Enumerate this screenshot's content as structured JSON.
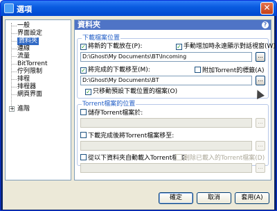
{
  "window": {
    "title": "選項",
    "close_label": "✕"
  },
  "tree": {
    "items": [
      {
        "label": "一般"
      },
      {
        "label": "界面設定"
      },
      {
        "label": "資料夾"
      },
      {
        "label": "連線"
      },
      {
        "label": "流量"
      },
      {
        "label": "BitTorrent"
      },
      {
        "label": "佇列限制"
      },
      {
        "label": "排程"
      },
      {
        "label": "排程器"
      },
      {
        "label": "網頁界面"
      },
      {
        "label": "進階"
      }
    ],
    "expander": "+"
  },
  "panel": {
    "title": "資料夾",
    "help": "?",
    "download_group": {
      "label": "下載檔案位置",
      "new_downloads_cb": "將新的下載放在(P):",
      "show_dialog_cb": "手動增加時永遠顯示對話視窗(W)",
      "new_downloads_path": "D:\\Ghost\\My Documents\\BT\\Incoming",
      "move_completed_cb": "將完成的下載移至(M):",
      "append_label_cb": "附加Torrent的標籤(A)",
      "move_completed_path": "D:\\Ghost\\My Documents\\BT",
      "only_default_cb": "只移動預設下載位置的檔案(O)",
      "browse": "..."
    },
    "torrent_group": {
      "label": "Torrent檔案的位置",
      "store_torrents_cb": "儲存Torrent檔案於:",
      "move_finished_torrents_cb": "下載完成後將Torrent檔案移至:",
      "autoload_cb": "從以下資料夾自動載入Torrent檔案:",
      "delete_loaded_cb": "刪除已載入的Torrent檔案(D)",
      "browse": "..."
    }
  },
  "buttons": {
    "ok": "確定",
    "cancel": "取消",
    "apply": "套用(A)"
  },
  "check_mark": "✓"
}
